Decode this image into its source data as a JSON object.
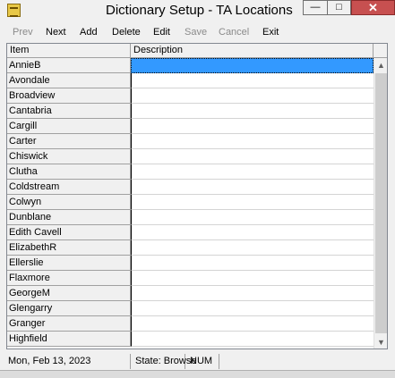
{
  "window": {
    "title": "Dictionary Setup - TA Locations",
    "controls": {
      "minimize": "—",
      "maximize": "□",
      "close": "✕"
    }
  },
  "toolbar": {
    "prev": "Prev",
    "next": "Next",
    "add": "Add",
    "delete": "Delete",
    "edit": "Edit",
    "save": "Save",
    "cancel": "Cancel",
    "exit": "Exit"
  },
  "grid": {
    "columns": [
      "Item",
      "Description"
    ],
    "rows": [
      {
        "item": "AnnieB",
        "description": ""
      },
      {
        "item": "Avondale",
        "description": ""
      },
      {
        "item": "Broadview",
        "description": ""
      },
      {
        "item": "Cantabria",
        "description": ""
      },
      {
        "item": "Cargill",
        "description": ""
      },
      {
        "item": "Carter",
        "description": ""
      },
      {
        "item": "Chiswick",
        "description": ""
      },
      {
        "item": "Clutha",
        "description": ""
      },
      {
        "item": "Coldstream",
        "description": ""
      },
      {
        "item": "Colwyn",
        "description": ""
      },
      {
        "item": "Dunblane",
        "description": ""
      },
      {
        "item": "Edith Cavell",
        "description": ""
      },
      {
        "item": "ElizabethR",
        "description": ""
      },
      {
        "item": "Ellerslie",
        "description": ""
      },
      {
        "item": "Flaxmore",
        "description": ""
      },
      {
        "item": "GeorgeM",
        "description": ""
      },
      {
        "item": "Glengarry",
        "description": ""
      },
      {
        "item": "Granger",
        "description": ""
      },
      {
        "item": "Highfield",
        "description": ""
      }
    ],
    "selected_row": 0
  },
  "status": {
    "date": "Mon, Feb 13, 2023",
    "state": "State: Browse",
    "num": "NUM"
  },
  "colors": {
    "selection": "#3399ff",
    "close_button": "#c75050",
    "disabled_text": "#8a8a8a"
  }
}
